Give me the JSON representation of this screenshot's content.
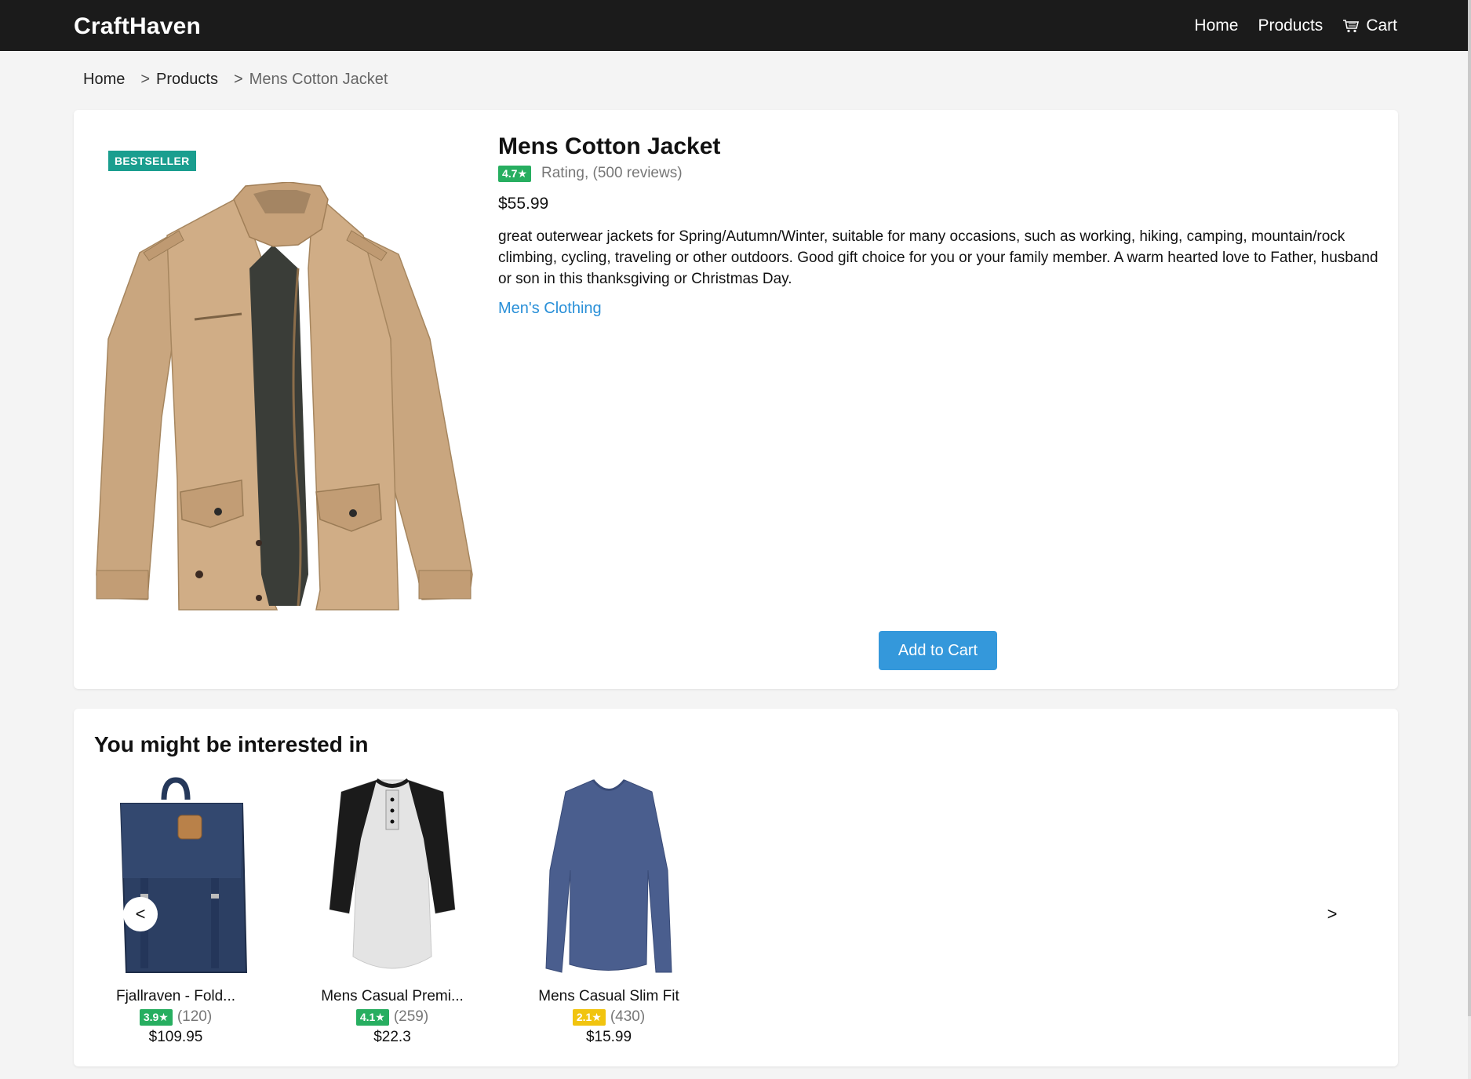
{
  "nav": {
    "brand": "CraftHaven",
    "links": [
      "Home",
      "Products",
      "Cart"
    ]
  },
  "breadcrumb": {
    "home": "Home",
    "sep": ">",
    "products": "Products",
    "current": "Mens Cotton Jacket"
  },
  "product": {
    "badge": "BESTSELLER",
    "title": "Mens Cotton Jacket",
    "rating": "4.7★",
    "rating_color": "#27ae60",
    "rating_text": "Rating, (500 reviews)",
    "price": "$55.99",
    "description": "great outerwear jackets for Spring/Autumn/Winter, suitable for many occasions, such as working, hiking, camping, mountain/rock climbing, cycling, traveling or other outdoors. Good gift choice for you or your family member. A warm hearted love to Father, husband or son in this thanksgiving or Christmas Day.",
    "category": "Men's Clothing",
    "add_to_cart": "Add to Cart"
  },
  "related": {
    "title": "You might be interested in",
    "prev": "<",
    "next": ">",
    "items": [
      {
        "name": "Fjallraven - Fold...",
        "rating": "3.9★",
        "rating_color": "#27ae60",
        "reviews": "(120)",
        "price": "$109.95"
      },
      {
        "name": "Mens Casual Premi...",
        "rating": "4.1★",
        "rating_color": "#27ae60",
        "reviews": "(259)",
        "price": "$22.3"
      },
      {
        "name": "Mens Casual Slim Fit",
        "rating": "2.1★",
        "rating_color": "#f1c40f",
        "reviews": "(430)",
        "price": "$15.99"
      }
    ]
  }
}
